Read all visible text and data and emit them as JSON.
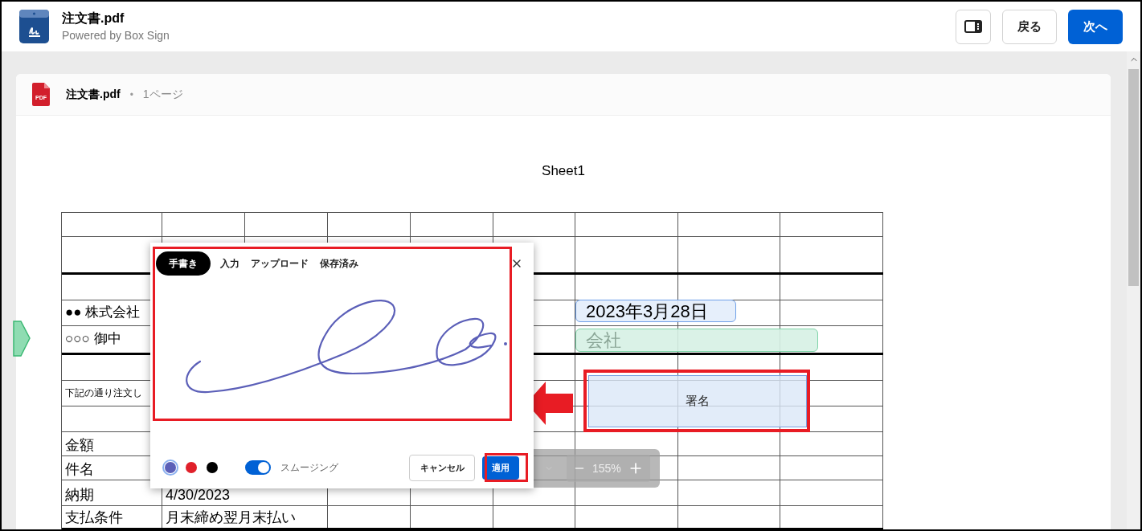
{
  "header": {
    "title": "注文書.pdf",
    "subtitle": "Powered by Box Sign",
    "buttons": [
      {
        "label": "戻る",
        "kind": "secondary"
      },
      {
        "label": "次へ",
        "kind": "primary"
      }
    ]
  },
  "document": {
    "file_icon_label": "PDF",
    "file_name": "注文書.pdf",
    "separator": "•",
    "page_count": "1ページ",
    "sheet_title": "Sheet1",
    "table_rows": [
      {
        "kind": "blank"
      },
      {
        "kind": "blank"
      },
      {
        "kind": "blank"
      },
      {
        "kind": "wide",
        "cells": [
          "●● 株式会社"
        ]
      },
      {
        "kind": "wide",
        "cells": [
          "○○○ 御中"
        ]
      },
      {
        "kind": "blank"
      },
      {
        "kind": "small",
        "cells": [
          "下記の通り注文し"
        ]
      },
      {
        "kind": "blank"
      },
      {
        "kind": "pair",
        "cells": [
          "金額"
        ]
      },
      {
        "kind": "pair",
        "cells": [
          "件名"
        ]
      },
      {
        "kind": "pair",
        "cells": [
          "納期",
          "4/30/2023"
        ]
      },
      {
        "kind": "pair",
        "cells": [
          "支払条件",
          "月末締め翌月末払い"
        ]
      }
    ],
    "fields": [
      {
        "kind": "date",
        "value": "2023年3月28日"
      },
      {
        "kind": "text",
        "placeholder": "会社"
      },
      {
        "kind": "signature",
        "label": "署名"
      }
    ],
    "zoom_level": "155%"
  },
  "signature_dialog": {
    "tabs": [
      {
        "label": "手書き",
        "selected": true
      },
      {
        "label": "入力",
        "selected": false
      },
      {
        "label": "アップロード",
        "selected": false
      },
      {
        "label": "保存済み",
        "selected": false
      }
    ],
    "colors": [
      {
        "color": "#5b5fb8",
        "selected": true
      },
      {
        "color": "#e0202a",
        "selected": false
      },
      {
        "color": "#000000",
        "selected": false
      }
    ],
    "smoothing": {
      "label": "スムージング",
      "on": true
    },
    "buttons": [
      {
        "label": "キャンセル",
        "kind": "secondary"
      },
      {
        "label": "適用",
        "kind": "primary"
      }
    ]
  }
}
